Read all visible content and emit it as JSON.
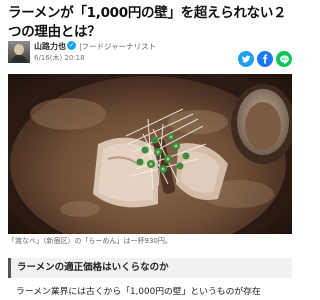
{
  "article": {
    "title": "ラーメンが「1,000円の壁」を超えられない２つの理由とは？"
  },
  "author": {
    "name": "山路力也",
    "verified_icon": "verified-check-icon",
    "role": "フードジャーナリスト",
    "date": "6/16(木) 20:18"
  },
  "share": {
    "twitter_icon": "twitter-bird-icon",
    "facebook_icon": "facebook-f-icon",
    "line_icon": "line-chat-icon",
    "colors": {
      "twitter": "#1da1f2",
      "facebook": "#1877f2",
      "line": "#06c755"
    }
  },
  "photo": {
    "caption": "「渡なべ」（新宿区）の「らーめん」は一杯930円。"
  },
  "section": {
    "heading": "ラーメンの適正価格はいくらなのか"
  },
  "body": {
    "first_line": "ラーメン業界には古くから「1,000円の壁」というものが存在"
  }
}
